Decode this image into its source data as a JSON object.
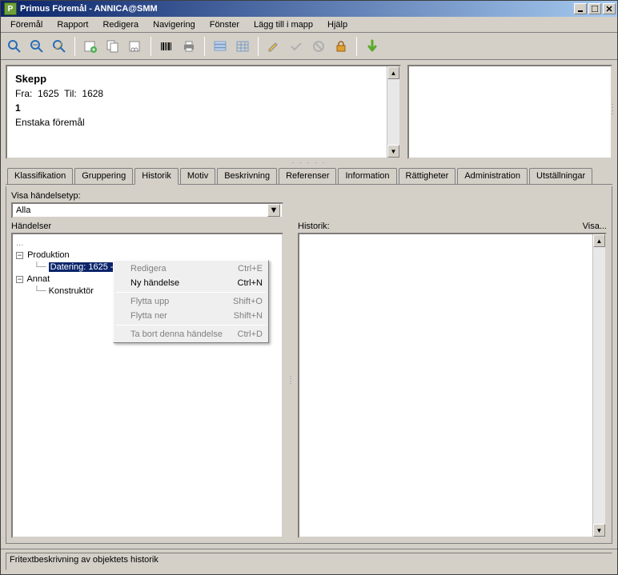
{
  "window": {
    "title": "Primus Föremål - ANNICA@SMM"
  },
  "menubar": {
    "items": [
      "Föremål",
      "Rapport",
      "Redigera",
      "Navigering",
      "Fönster",
      "Lägg till i mapp",
      "Hjälp"
    ]
  },
  "info_panel": {
    "obj_label": "Skepp",
    "fra_label": "Fra:",
    "fra_val": "1625",
    "til_label": "Til:",
    "til_val": "1628",
    "num": "1",
    "desc": "Enstaka föremål"
  },
  "tabs": {
    "items": [
      "Klassifikation",
      "Gruppering",
      "Historik",
      "Motiv",
      "Beskrivning",
      "Referenser",
      "Information",
      "Rättigheter",
      "Administration",
      "Utställningar"
    ],
    "active_index": 2
  },
  "filter": {
    "label": "Visa händelsetyp:",
    "value": "Alla"
  },
  "left_header": "Händelser",
  "right_header": "Historik:",
  "visa_link": "Visa...",
  "tree": {
    "root_dots": "...",
    "n1": "Produktion",
    "n1a": "Datering: 1625 - 1628",
    "n2": "Annat",
    "n2a": "Konstruktör"
  },
  "context_menu": {
    "items": [
      {
        "label": "Redigera",
        "shortcut": "Ctrl+E",
        "disabled": true
      },
      {
        "label": "Ny händelse",
        "shortcut": "Ctrl+N",
        "disabled": false
      },
      {
        "sep": true
      },
      {
        "label": "Flytta upp",
        "shortcut": "Shift+O",
        "disabled": true
      },
      {
        "label": "Flytta ner",
        "shortcut": "Shift+N",
        "disabled": true
      },
      {
        "sep": true
      },
      {
        "label": "Ta bort denna händelse",
        "shortcut": "Ctrl+D",
        "disabled": true
      }
    ]
  },
  "statusbar": {
    "text": "Fritextbeskrivning av objektets historik"
  }
}
